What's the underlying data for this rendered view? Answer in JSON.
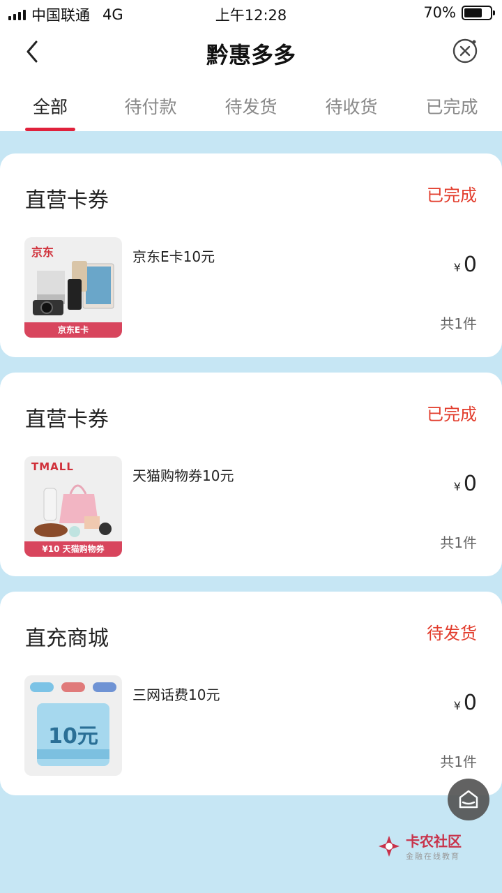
{
  "status_bar": {
    "carrier": "中国联通",
    "network": "4G",
    "time": "上午12:28",
    "battery_text": "70%",
    "battery_level": 0.7
  },
  "nav": {
    "title": "黔惠多多"
  },
  "tabs": [
    "全部",
    "待付款",
    "待发货",
    "待收货",
    "已完成"
  ],
  "orders": [
    {
      "title": "直营卡券",
      "status": "已完成",
      "item_name": "京东E卡10元",
      "price_symbol": "¥",
      "price": "0",
      "count": "共1件",
      "thumb": {
        "brand": "京东",
        "ribbon": "京东E卡"
      }
    },
    {
      "title": "直营卡券",
      "status": "已完成",
      "item_name": "天猫购物券10元",
      "price_symbol": "¥",
      "price": "0",
      "count": "共1件",
      "thumb": {
        "brand": "TMALL",
        "ribbon": "¥10 天猫购物券"
      }
    },
    {
      "title": "直充商城",
      "status": "待发货",
      "item_name": "三网话费10元",
      "price_symbol": "¥",
      "price": "0",
      "count": "共1件",
      "thumb": {
        "amount": "10元"
      }
    }
  ],
  "watermark": {
    "name": "卡农社区",
    "tagline": "金融在线教育"
  },
  "colors": {
    "accent": "#e0213b",
    "status": "#e23c2c",
    "background": "#c6e6f4"
  }
}
